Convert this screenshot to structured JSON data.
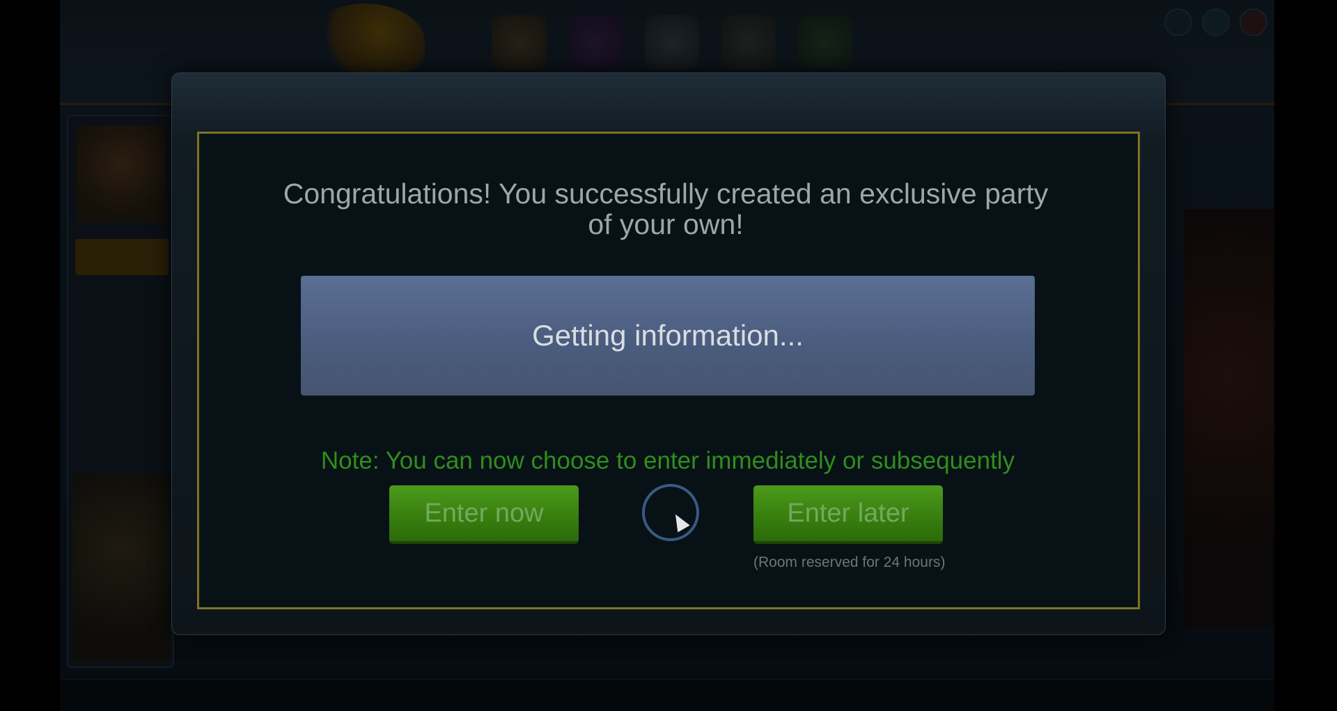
{
  "dialog": {
    "message": "Congratulations! You successfully created an exclusive party of your own!",
    "status_text": "Getting information...",
    "note": "Note: You can now choose to enter immediately or subsequently",
    "enter_now_label": "Enter now",
    "enter_later_label": "Enter later",
    "reserved_text": "(Room reserved for 24 hours)"
  },
  "colors": {
    "border_gold": "#7f7326",
    "button_green": "#3a8210",
    "note_green": "#2f8e1d",
    "info_box_blue": "#5b6f93"
  },
  "icons": {
    "nav": [
      "house-icon",
      "people-icon",
      "shield-icon",
      "bank-icon",
      "arrow-icon"
    ],
    "corner": [
      "settings-icon",
      "sound-icon",
      "close-icon"
    ]
  }
}
